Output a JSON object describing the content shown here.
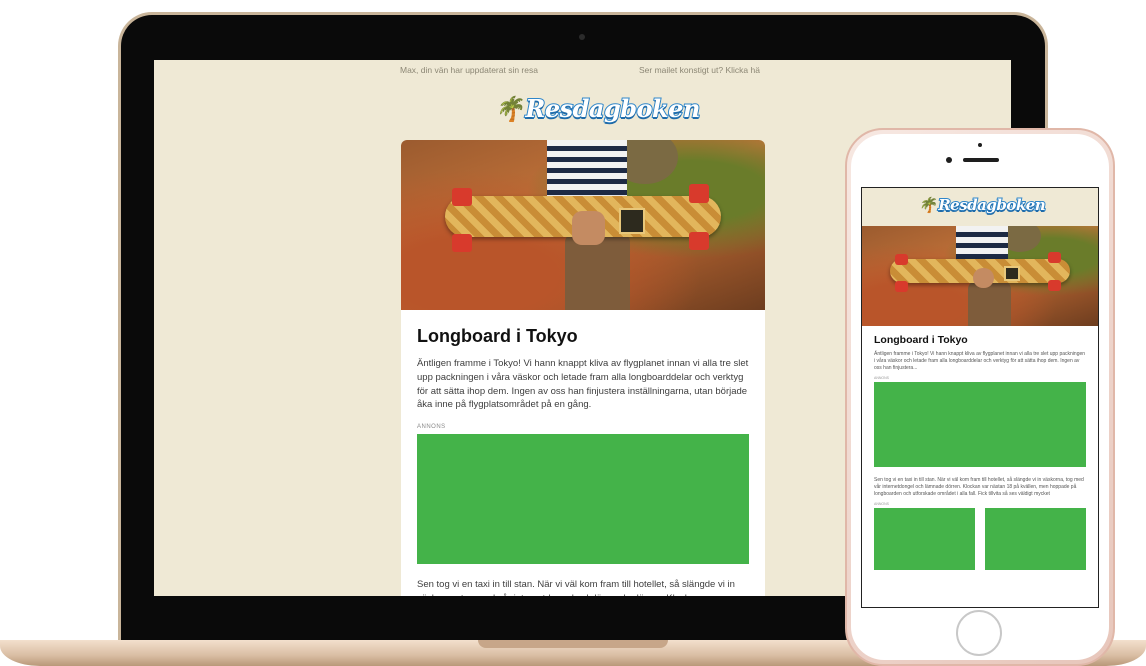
{
  "email": {
    "preheader_left": "Max, din vän har uppdaterat sin resa",
    "preheader_right": "Ser mailet konstigt ut? Klicka hä",
    "logo": "Resdagboken",
    "title": "Longboard i Tokyo",
    "intro": "Äntligen framme i Tokyo! Vi hann knappt kliva av flygplanet innan vi alla tre slet upp packningen i våra väskor och letade fram alla longboarddelar och verktyg för att sätta ihop dem. Ingen av oss han finjustera inställningarna, utan började åka inne på flygplatsområdet på en gång.",
    "ad_label": "ANNONS",
    "body": "Sen tog vi en taxi in till stan. När vi väl kom fram till hotellet, så slängde vi in väskorna, tog med vår internetdongel och lämnade dörren. Klockan var",
    "phone_intro": "Äntligen framme i Tokyo! Vi hann knappt kliva av flygplanet innan vi alla tre slet upp packningen i våra väskor och letade fram alla longboarddelar och verktyg för att sätta ihop dem. Ingen av oss han finjustera...",
    "phone_body": "Sen tog vi en taxi in till stan. När vi väl kom fram till hotellet, så slängde vi in väskorna, tog med vår internetdongel och lämnade dörren. Klockan var nästan 18 på kvällen, men hoppade på longboarden och utforskade området i alla fall. Fick tillvita så ses väldigt mycket"
  },
  "colors": {
    "email_bg": "#efe9d5",
    "ad_green": "#44b349",
    "logo_blue": "#2f86c9"
  }
}
